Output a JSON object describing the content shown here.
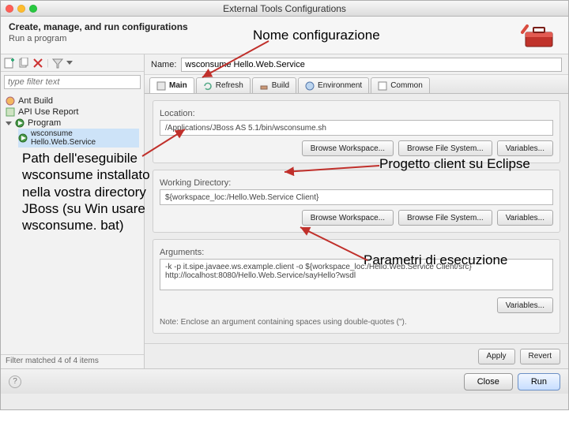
{
  "window_title": "External Tools Configurations",
  "header": {
    "title": "Create, manage, and run configurations",
    "subtitle": "Run a program"
  },
  "left": {
    "filter_placeholder": "type filter text",
    "items": [
      "Ant Build",
      "API Use Report"
    ],
    "program_label": "Program",
    "program_child": "wsconsume Hello.Web.Service",
    "status": "Filter matched 4 of 4 items"
  },
  "form": {
    "name_label": "Name:",
    "name_value": "wsconsume Hello.Web.Service"
  },
  "tabs": [
    "Main",
    "Refresh",
    "Build",
    "Environment",
    "Common"
  ],
  "main_tab": {
    "location_label": "Location:",
    "location_value": "/Applications/JBoss AS 5.1/bin/wsconsume.sh",
    "workdir_label": "Working Directory:",
    "workdir_value": "${workspace_loc:/Hello.Web.Service Client}",
    "args_label": "Arguments:",
    "args_value": "-k -p it.sipe.javaee.ws.example.client -o ${workspace_loc:/Hello.Web.Service Client/src} http://localhost:8080/Hello.Web.Service/sayHello?wsdl",
    "note": "Note: Enclose an argument containing spaces using double-quotes (\").",
    "browse_workspace": "Browse Workspace...",
    "browse_filesystem": "Browse File System...",
    "variables": "Variables...",
    "apply": "Apply",
    "revert": "Revert"
  },
  "footer": {
    "close": "Close",
    "run": "Run"
  },
  "annotations": {
    "a1": "Nome configurazione",
    "a2": "Path dell'eseguibile wsconsume installato nella vostra directory JBoss (su Win usare wsconsume. bat)",
    "a3": "Progetto client su Eclipse",
    "a4": "Parametri di esecuzione"
  }
}
